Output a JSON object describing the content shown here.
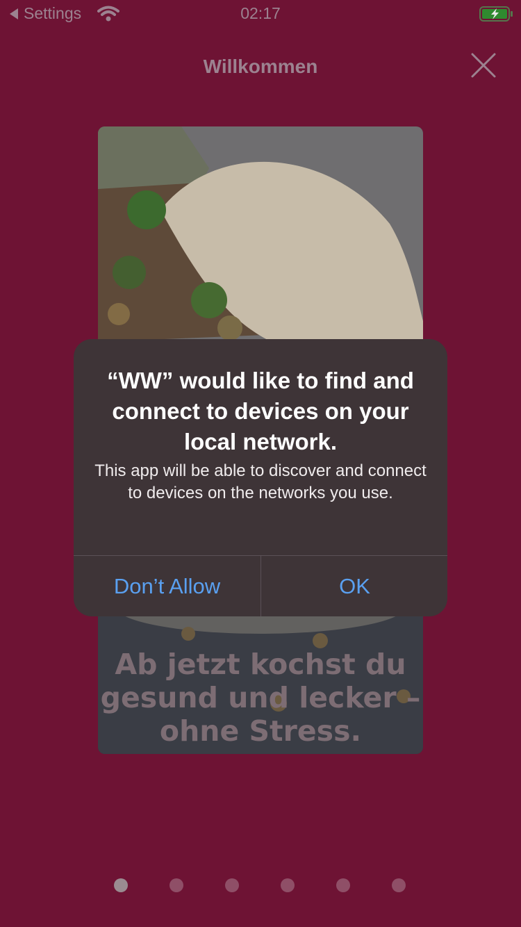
{
  "status_bar": {
    "back_label": "Settings",
    "time": "02:17"
  },
  "header": {
    "title": "Willkommen"
  },
  "card": {
    "headline": "Ab jetzt kochst du\ngesund und lecker –\nohne Stress."
  },
  "pager": {
    "count": 6,
    "active_index": 0
  },
  "alert": {
    "title": "“WW” would like to find and connect to devices on your local network.",
    "message": "This app will be able to discover and connect to devices on the networks you use.",
    "deny_label": "Don’t Allow",
    "allow_label": "OK"
  },
  "colors": {
    "background": "#6e1334",
    "alert_background": "#3e3437",
    "alert_button_text": "#5aa0f0"
  }
}
